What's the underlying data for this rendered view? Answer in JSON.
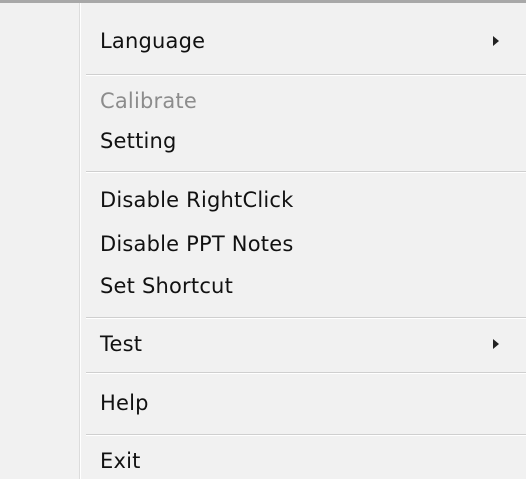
{
  "menu": {
    "items": [
      {
        "label": "Language",
        "submenu_icon": "chevron-right-icon"
      },
      {
        "label": "Calibrate",
        "disabled": true
      },
      {
        "label": "Setting"
      },
      {
        "label": "Disable RightClick"
      },
      {
        "label": "Disable PPT Notes"
      },
      {
        "label": "Set Shortcut"
      },
      {
        "label": "Test",
        "submenu_icon": "chevron-right-icon"
      },
      {
        "label": "Help"
      },
      {
        "label": "Exit"
      }
    ]
  }
}
